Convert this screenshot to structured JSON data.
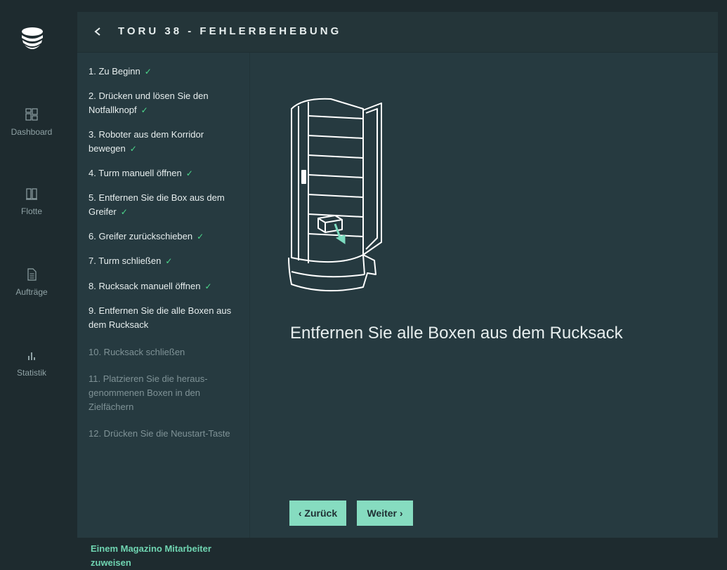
{
  "nav": {
    "items": [
      {
        "label": "Dashboard",
        "icon": "dashboard-icon"
      },
      {
        "label": "Flotte",
        "icon": "fleet-icon"
      },
      {
        "label": "Aufträge",
        "icon": "orders-icon"
      },
      {
        "label": "Statistik",
        "icon": "statistics-icon"
      }
    ]
  },
  "header": {
    "back_icon": "chevron-left-icon",
    "title": "TORU 38 - FEHLERBEHEBUNG"
  },
  "steps": [
    {
      "label": "1. Zu Beginn",
      "done": true
    },
    {
      "label": "2. Drücken und lösen Sie den Notfallknopf",
      "done": true
    },
    {
      "label": "3. Roboter aus dem Korridor bewegen",
      "done": true
    },
    {
      "label": "4. Turm manuell öffnen",
      "done": true
    },
    {
      "label": "5. Entfernen Sie die Box aus dem Greifer",
      "done": true
    },
    {
      "label": "6. Greifer zurückschieben",
      "done": true
    },
    {
      "label": "7. Turm schließen",
      "done": true
    },
    {
      "label": "8. Rucksack manuell öffnen",
      "done": true
    },
    {
      "label": "9. Entfernen Sie die alle Boxen aus dem Rucksack",
      "done": false,
      "current": true
    },
    {
      "label": "10. Rucksack schließen",
      "done": false
    },
    {
      "label": "11. Platzieren Sie die heraus-genommenen Boxen in den Zielfächern",
      "done": false
    },
    {
      "label": "12. Drücken Sie die Neustart-Taste",
      "done": false
    }
  ],
  "check_glyph": "✓",
  "assign_label": "Einem Magazino Mitarbeiter zuweisen",
  "content": {
    "instruction": "Entfernen Sie alle Boxen aus dem Rucksack"
  },
  "buttons": {
    "back_label": "‹ Zurück",
    "next_label": "Weiter ›"
  },
  "colors": {
    "accent": "#86dcc0",
    "check": "#4cd98c",
    "panel": "#263a40",
    "background": "#1e2b2f"
  }
}
